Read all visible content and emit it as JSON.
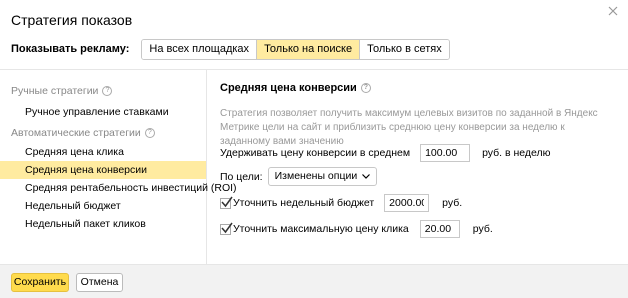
{
  "dialog": {
    "title": "Стратегия показов"
  },
  "show_ads": {
    "label": "Показывать рекламу:",
    "options": [
      "На всех площадках",
      "Только на поиске",
      "Только в сетях"
    ],
    "selected": "Только на поиске"
  },
  "sidebar": {
    "manual_group": "Ручные стратегии",
    "manual_items": [
      "Ручное управление ставками"
    ],
    "auto_group": "Автоматические стратегии",
    "auto_items": [
      "Средняя цена клика",
      "Средняя цена конверсии",
      "Средняя рентабельность инвестиций (ROI)",
      "Недельный бюджет",
      "Недельный пакет кликов"
    ],
    "selected": "Средняя цена конверсии"
  },
  "content": {
    "title": "Средняя цена конверсии",
    "description": "Стратегия позволяет получить максимум целевых визитов по заданной в Яндекс Метрике цели на сайт и приблизить среднюю цену конверсии за неделю к заданному вами значению",
    "hold_label": "Удерживать цену конверсии в среднем",
    "hold_value": "100.00",
    "hold_unit": "руб. в неделю",
    "goal_label": "По цели:",
    "goal_value": "Изменены опции",
    "budget_checked": true,
    "budget_label": "Уточнить недельный бюджет",
    "budget_value": "2000.00",
    "budget_unit": "руб.",
    "maxprice_checked": true,
    "maxprice_label": "Уточнить максимальную цену клика",
    "maxprice_value": "20.00",
    "maxprice_unit": "руб."
  },
  "footer": {
    "save_label": "Сохранить",
    "cancel_label": "Отмена"
  },
  "colors": {
    "accent_yellow": "#ffdb4d",
    "selection_yellow": "#ffeba0",
    "muted_text": "#999999"
  }
}
